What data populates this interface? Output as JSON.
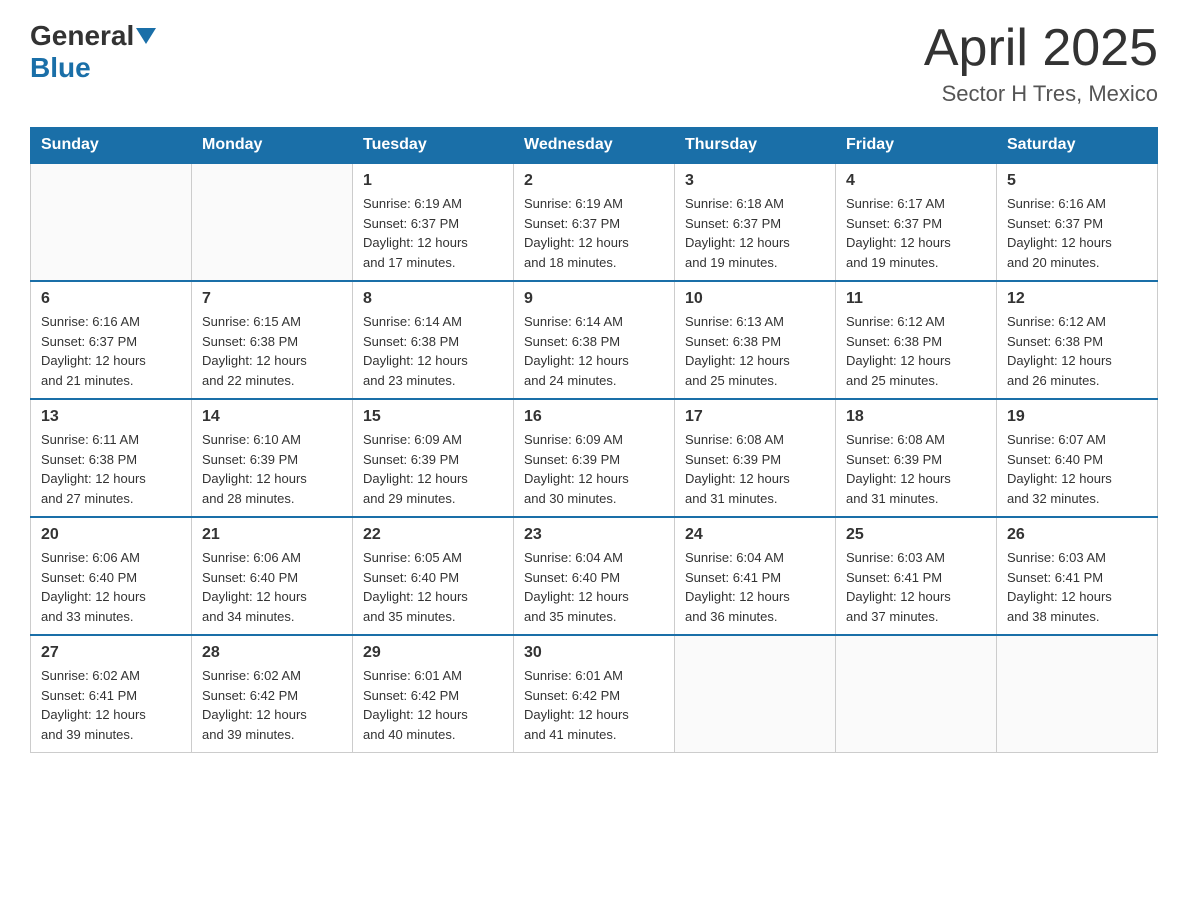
{
  "header": {
    "logo": {
      "general": "General",
      "blue": "Blue"
    },
    "title": "April 2025",
    "location": "Sector H Tres, Mexico"
  },
  "calendar": {
    "days_of_week": [
      "Sunday",
      "Monday",
      "Tuesday",
      "Wednesday",
      "Thursday",
      "Friday",
      "Saturday"
    ],
    "weeks": [
      [
        {
          "day": "",
          "info": ""
        },
        {
          "day": "",
          "info": ""
        },
        {
          "day": "1",
          "info": "Sunrise: 6:19 AM\nSunset: 6:37 PM\nDaylight: 12 hours\nand 17 minutes."
        },
        {
          "day": "2",
          "info": "Sunrise: 6:19 AM\nSunset: 6:37 PM\nDaylight: 12 hours\nand 18 minutes."
        },
        {
          "day": "3",
          "info": "Sunrise: 6:18 AM\nSunset: 6:37 PM\nDaylight: 12 hours\nand 19 minutes."
        },
        {
          "day": "4",
          "info": "Sunrise: 6:17 AM\nSunset: 6:37 PM\nDaylight: 12 hours\nand 19 minutes."
        },
        {
          "day": "5",
          "info": "Sunrise: 6:16 AM\nSunset: 6:37 PM\nDaylight: 12 hours\nand 20 minutes."
        }
      ],
      [
        {
          "day": "6",
          "info": "Sunrise: 6:16 AM\nSunset: 6:37 PM\nDaylight: 12 hours\nand 21 minutes."
        },
        {
          "day": "7",
          "info": "Sunrise: 6:15 AM\nSunset: 6:38 PM\nDaylight: 12 hours\nand 22 minutes."
        },
        {
          "day": "8",
          "info": "Sunrise: 6:14 AM\nSunset: 6:38 PM\nDaylight: 12 hours\nand 23 minutes."
        },
        {
          "day": "9",
          "info": "Sunrise: 6:14 AM\nSunset: 6:38 PM\nDaylight: 12 hours\nand 24 minutes."
        },
        {
          "day": "10",
          "info": "Sunrise: 6:13 AM\nSunset: 6:38 PM\nDaylight: 12 hours\nand 25 minutes."
        },
        {
          "day": "11",
          "info": "Sunrise: 6:12 AM\nSunset: 6:38 PM\nDaylight: 12 hours\nand 25 minutes."
        },
        {
          "day": "12",
          "info": "Sunrise: 6:12 AM\nSunset: 6:38 PM\nDaylight: 12 hours\nand 26 minutes."
        }
      ],
      [
        {
          "day": "13",
          "info": "Sunrise: 6:11 AM\nSunset: 6:38 PM\nDaylight: 12 hours\nand 27 minutes."
        },
        {
          "day": "14",
          "info": "Sunrise: 6:10 AM\nSunset: 6:39 PM\nDaylight: 12 hours\nand 28 minutes."
        },
        {
          "day": "15",
          "info": "Sunrise: 6:09 AM\nSunset: 6:39 PM\nDaylight: 12 hours\nand 29 minutes."
        },
        {
          "day": "16",
          "info": "Sunrise: 6:09 AM\nSunset: 6:39 PM\nDaylight: 12 hours\nand 30 minutes."
        },
        {
          "day": "17",
          "info": "Sunrise: 6:08 AM\nSunset: 6:39 PM\nDaylight: 12 hours\nand 31 minutes."
        },
        {
          "day": "18",
          "info": "Sunrise: 6:08 AM\nSunset: 6:39 PM\nDaylight: 12 hours\nand 31 minutes."
        },
        {
          "day": "19",
          "info": "Sunrise: 6:07 AM\nSunset: 6:40 PM\nDaylight: 12 hours\nand 32 minutes."
        }
      ],
      [
        {
          "day": "20",
          "info": "Sunrise: 6:06 AM\nSunset: 6:40 PM\nDaylight: 12 hours\nand 33 minutes."
        },
        {
          "day": "21",
          "info": "Sunrise: 6:06 AM\nSunset: 6:40 PM\nDaylight: 12 hours\nand 34 minutes."
        },
        {
          "day": "22",
          "info": "Sunrise: 6:05 AM\nSunset: 6:40 PM\nDaylight: 12 hours\nand 35 minutes."
        },
        {
          "day": "23",
          "info": "Sunrise: 6:04 AM\nSunset: 6:40 PM\nDaylight: 12 hours\nand 35 minutes."
        },
        {
          "day": "24",
          "info": "Sunrise: 6:04 AM\nSunset: 6:41 PM\nDaylight: 12 hours\nand 36 minutes."
        },
        {
          "day": "25",
          "info": "Sunrise: 6:03 AM\nSunset: 6:41 PM\nDaylight: 12 hours\nand 37 minutes."
        },
        {
          "day": "26",
          "info": "Sunrise: 6:03 AM\nSunset: 6:41 PM\nDaylight: 12 hours\nand 38 minutes."
        }
      ],
      [
        {
          "day": "27",
          "info": "Sunrise: 6:02 AM\nSunset: 6:41 PM\nDaylight: 12 hours\nand 39 minutes."
        },
        {
          "day": "28",
          "info": "Sunrise: 6:02 AM\nSunset: 6:42 PM\nDaylight: 12 hours\nand 39 minutes."
        },
        {
          "day": "29",
          "info": "Sunrise: 6:01 AM\nSunset: 6:42 PM\nDaylight: 12 hours\nand 40 minutes."
        },
        {
          "day": "30",
          "info": "Sunrise: 6:01 AM\nSunset: 6:42 PM\nDaylight: 12 hours\nand 41 minutes."
        },
        {
          "day": "",
          "info": ""
        },
        {
          "day": "",
          "info": ""
        },
        {
          "day": "",
          "info": ""
        }
      ]
    ]
  }
}
